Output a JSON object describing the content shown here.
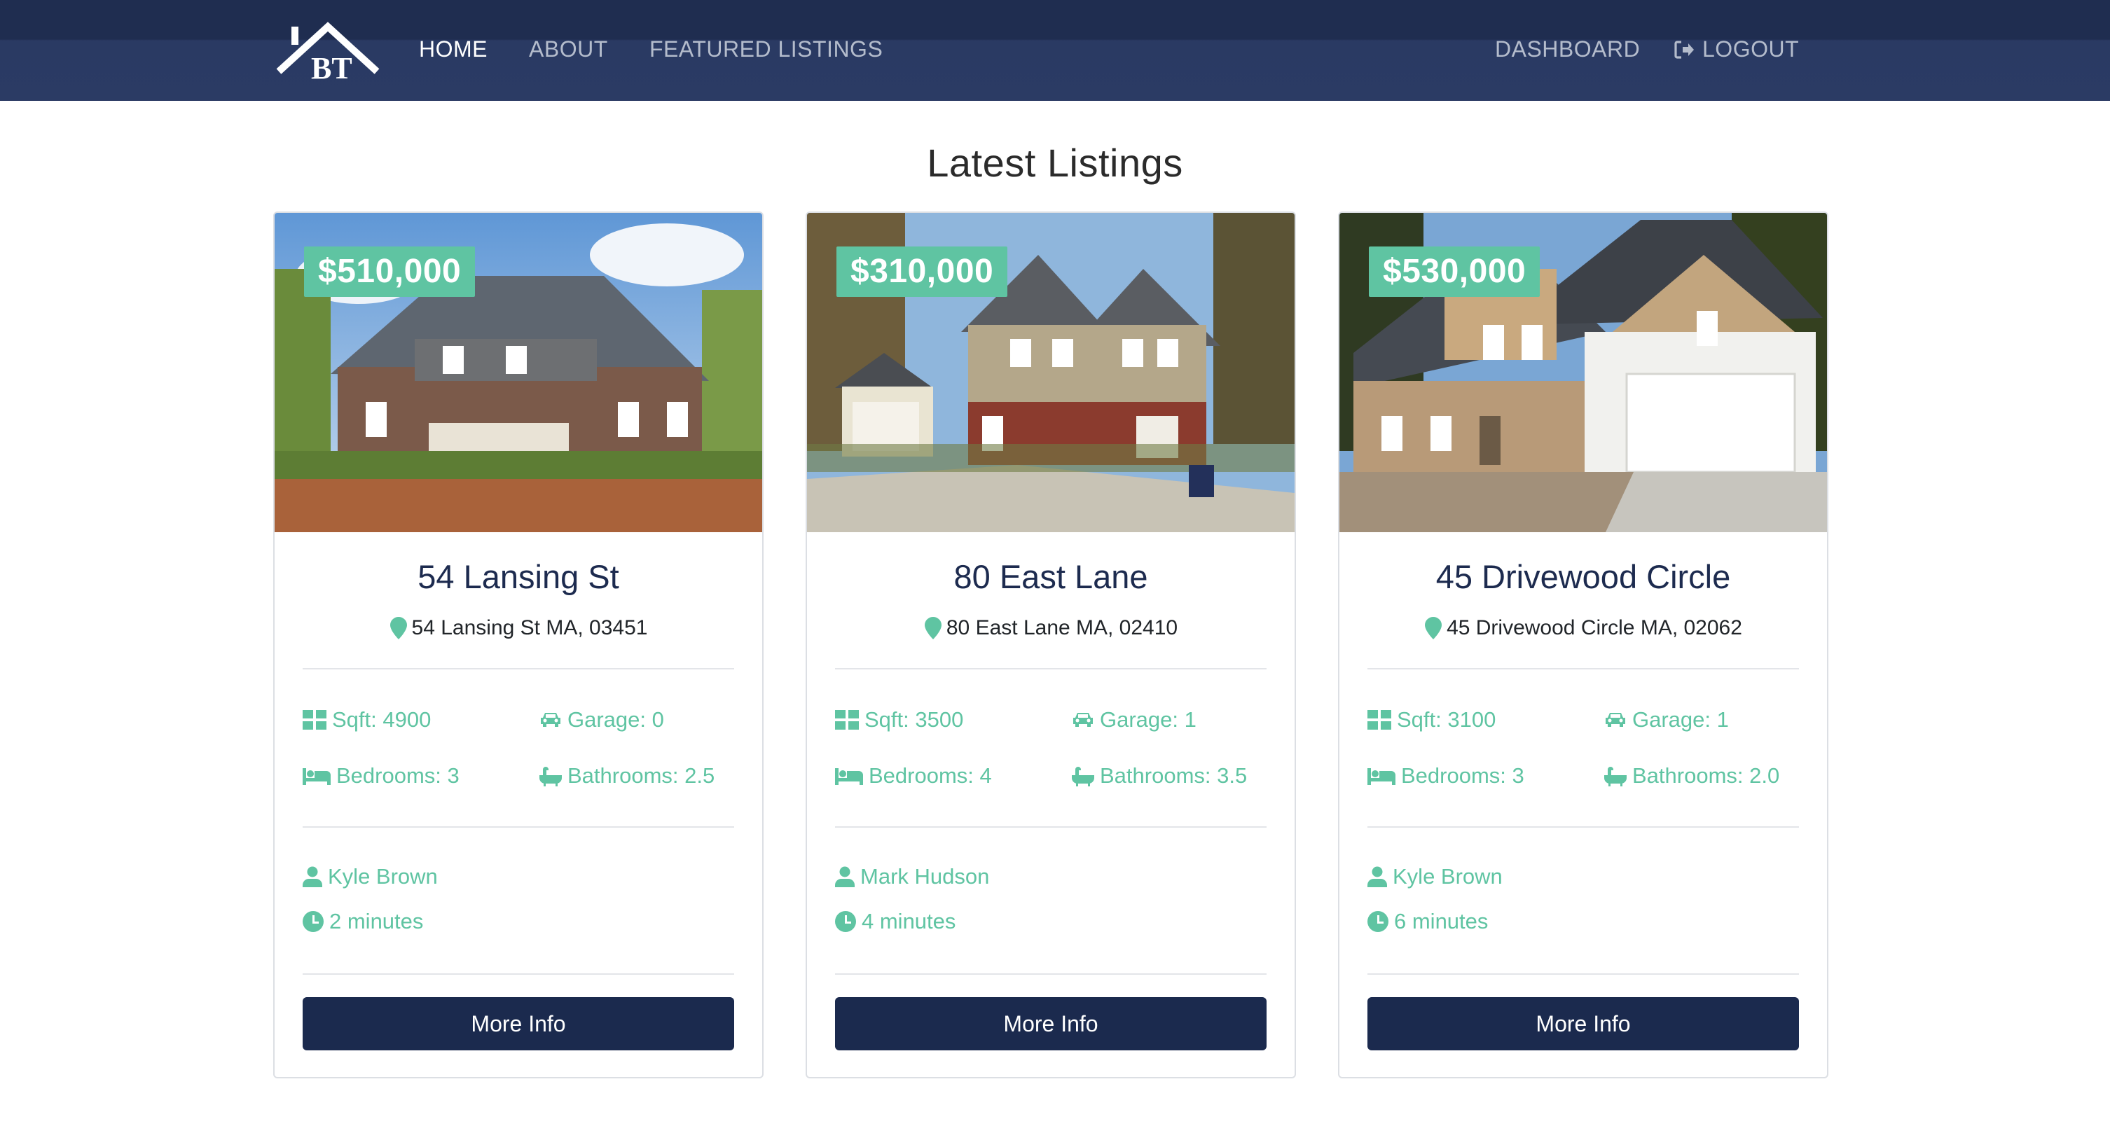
{
  "nav": {
    "brand": "BT",
    "home": "HOME",
    "about": "ABOUT",
    "featured": "FEATURED LISTINGS",
    "dashboard": "DASHBOARD",
    "logout": "LOGOUT"
  },
  "section_title": "Latest Listings",
  "colors": {
    "navbar": "#2b3b64",
    "accent": "#5fc4a2",
    "button": "#1b2a4e"
  },
  "listings": [
    {
      "price": "$510,000",
      "title": "54 Lansing St",
      "address": "54 Lansing St MA, 03451",
      "sqft": "Sqft: 4900",
      "garage": "Garage: 0",
      "bedrooms": "Bedrooms: 3",
      "bathrooms": "Bathrooms: 2.5",
      "agent": "Kyle Brown",
      "time": "2 minutes",
      "button": "More Info"
    },
    {
      "price": "$310,000",
      "title": "80 East Lane",
      "address": "80 East Lane MA, 02410",
      "sqft": "Sqft: 3500",
      "garage": "Garage: 1",
      "bedrooms": "Bedrooms: 4",
      "bathrooms": "Bathrooms: 3.5",
      "agent": "Mark Hudson",
      "time": "4 minutes",
      "button": "More Info"
    },
    {
      "price": "$530,000",
      "title": "45 Drivewood Circle",
      "address": "45 Drivewood Circle MA, 02062",
      "sqft": "Sqft: 3100",
      "garage": "Garage: 1",
      "bedrooms": "Bedrooms: 3",
      "bathrooms": "Bathrooms: 2.0",
      "agent": "Kyle Brown",
      "time": "6 minutes",
      "button": "More Info"
    }
  ],
  "icons": [
    "map-marker-icon",
    "grid-icon",
    "car-icon",
    "bed-icon",
    "bath-icon",
    "user-icon",
    "clock-icon",
    "sign-out-icon"
  ]
}
